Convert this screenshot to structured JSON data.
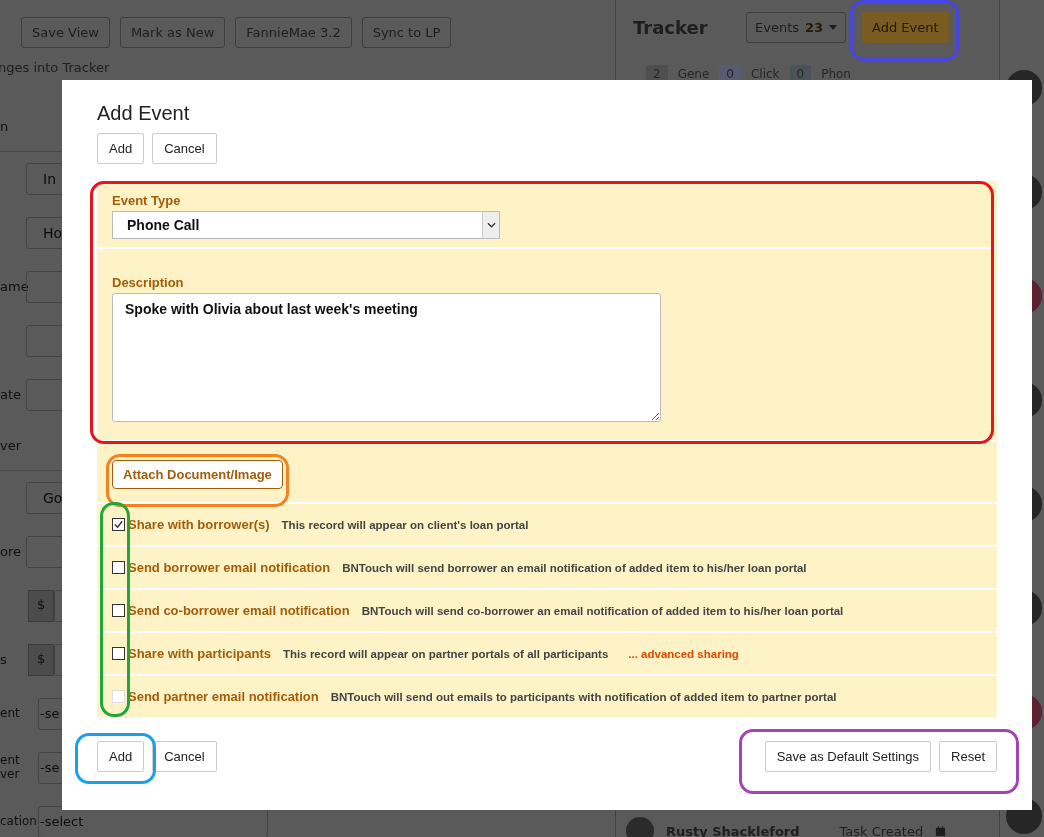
{
  "background": {
    "toolbar": [
      "Save View",
      "Mark as New",
      "FannieMae 3.2",
      "Sync to LP"
    ],
    "notice": "nges into Tracker",
    "form": [
      {
        "kind": "header",
        "label": "n"
      },
      {
        "kind": "field",
        "value": "In"
      },
      {
        "kind": "field",
        "value": "Ho"
      },
      {
        "kind": "field",
        "label": "ame"
      },
      {
        "kind": "field"
      },
      {
        "kind": "field",
        "label": "ate"
      },
      {
        "kind": "header",
        "label": "ver"
      },
      {
        "kind": "field",
        "value": "Go"
      },
      {
        "kind": "field",
        "label": "ore"
      },
      {
        "kind": "money",
        "prefix": "$"
      },
      {
        "kind": "money",
        "prefix": "$",
        "label": "s"
      },
      {
        "kind": "select",
        "label": "ent",
        "value": "-se"
      },
      {
        "kind": "select",
        "label": "ent ver",
        "value": "-se"
      },
      {
        "kind": "select",
        "label": "cation",
        "value": "-select"
      }
    ]
  },
  "tracker": {
    "title": "Tracker",
    "filter": {
      "label": "Events",
      "count": "23"
    },
    "add_button": "Add Event",
    "counters": [
      {
        "count": "2",
        "label": "Gene",
        "color": "#4f4f4f"
      },
      {
        "count": "0",
        "label": "Click",
        "color": "#5a5a74"
      },
      {
        "count": "0",
        "label": "Phon",
        "color": "#4a5456"
      }
    ],
    "feed": [
      {
        "name": "Rusty Shackleford",
        "status": "Task Created"
      }
    ]
  },
  "dialog": {
    "title": "Add Event",
    "top_buttons": [
      "Add",
      "Cancel"
    ],
    "event_type": {
      "label": "Event Type",
      "value": "Phone Call"
    },
    "description": {
      "label": "Description",
      "value": "Spoke with Olivia about last week's meeting"
    },
    "attach_button": "Attach Document/Image",
    "options": [
      {
        "label": "Share with borrower(s)",
        "note": "This record will appear on client's loan portal",
        "checked": true,
        "disabled": false
      },
      {
        "label": "Send borrower email notification",
        "note": "BNTouch will send borrower an email notification of added item to his/her loan portal",
        "checked": false,
        "disabled": false
      },
      {
        "label": "Send co-borrower email notification",
        "note": "BNTouch will send co-borrower an email notification of added item to his/her loan portal",
        "checked": false,
        "disabled": false
      },
      {
        "label": "Share with participants",
        "note": "This record will appear on partner portals of all participants",
        "link": "... advanced sharing",
        "checked": false,
        "disabled": false
      },
      {
        "label": "Send partner email notification",
        "note": "BNTouch will send out emails to participants with notification of added item to partner portal",
        "checked": false,
        "disabled": true
      }
    ],
    "footer_left": [
      "Add",
      "Cancel"
    ],
    "footer_right": [
      "Save as Default Settings",
      "Reset"
    ]
  },
  "annotations": [
    {
      "color": "#4646e6"
    },
    {
      "color": "#e8141b"
    },
    {
      "color": "#f58220"
    },
    {
      "color": "#1ea83c"
    },
    {
      "color": "#1aa0e6"
    },
    {
      "color": "#a443b4"
    }
  ]
}
